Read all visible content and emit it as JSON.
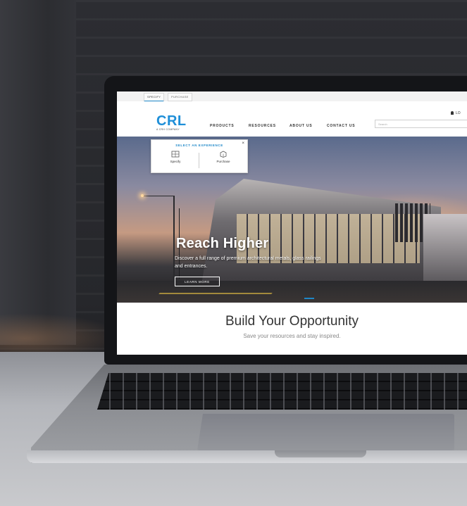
{
  "site": {
    "tabs": [
      "SPECIFY",
      "PURCHASE"
    ],
    "logo": "CRL",
    "logo_sub": "A CRH COMPANY",
    "nav": [
      "PRODUCTS",
      "RESOURCES",
      "ABOUT US",
      "CONTACT US"
    ],
    "search_placeholder": "Search",
    "login_label": "LO",
    "popup": {
      "title": "SELECT AN EXPERIENCE",
      "options": [
        "Specify",
        "Purchase"
      ],
      "close": "×"
    },
    "hero": {
      "title": "Reach Higher",
      "subtitle": "Discover a full range of premium architectural metals, glass railings and entrances.",
      "button": "LEARN MORE"
    },
    "section": {
      "title": "Build Your Opportunity",
      "subtitle": "Save your resources and stay inspired."
    }
  }
}
